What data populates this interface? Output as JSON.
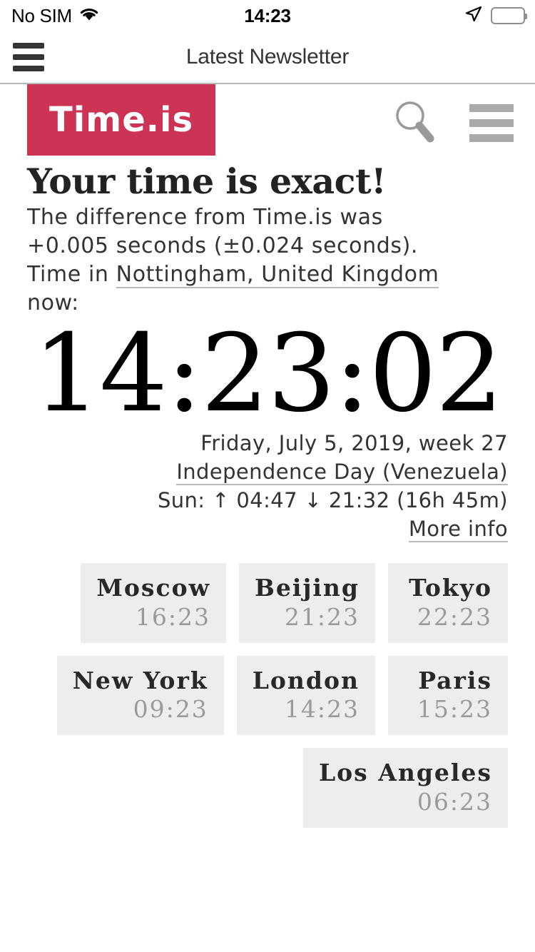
{
  "status_bar": {
    "carrier": "No SIM",
    "time": "14:23",
    "wifi_icon": "wifi-icon",
    "location_icon": "location-arrow-icon",
    "battery_icon": "battery-full-icon"
  },
  "nav_bar": {
    "menu_icon": "hamburger-menu-icon",
    "title": "Latest Newsletter"
  },
  "site_header": {
    "logo_text": "Time.is",
    "logo_color": "#cc3355",
    "search_icon": "search-icon",
    "menu_icon": "hamburger-menu-icon"
  },
  "main": {
    "headline": "Your time is exact!",
    "difference_line_1": "The difference from Time.is was",
    "difference_line_2": "+0.005 seconds (±0.024 seconds).",
    "time_in_prefix": "Time in",
    "location_link": "Nottingham, United Kingdom",
    "time_in_suffix": "now:",
    "clock": "14:23:02",
    "date": "Friday, July 5, 2019, week 27",
    "holiday_link": "Independence Day (Venezuela)",
    "sun_line": "Sun: ↑ 04:47 ↓ 21:32 (16h 45m)",
    "more_info_link": "More info"
  },
  "cities": {
    "rows": [
      [
        {
          "name": "Moscow",
          "time": "16:23"
        },
        {
          "name": "Beijing",
          "time": "21:23"
        },
        {
          "name": "Tokyo",
          "time": "22:23"
        }
      ],
      [
        {
          "name": "New York",
          "time": "09:23"
        },
        {
          "name": "London",
          "time": "14:23"
        },
        {
          "name": "Paris",
          "time": "15:23"
        }
      ],
      [
        {
          "name": "Los Angeles",
          "time": "06:23"
        }
      ]
    ]
  }
}
